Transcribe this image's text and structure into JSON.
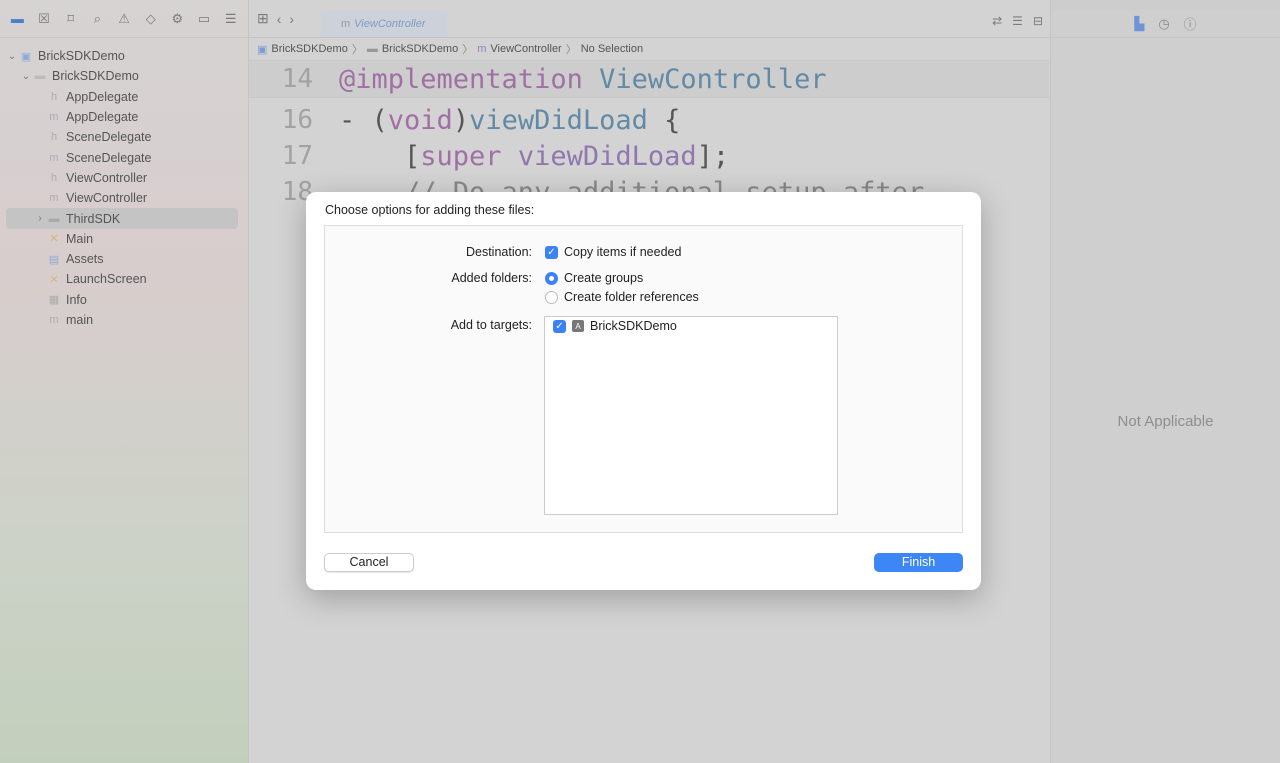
{
  "navigator": {
    "tools": [
      "folder-icon",
      "source-control-icon",
      "bookmark-icon",
      "search-icon",
      "warning-icon",
      "test-icon",
      "debug-icon",
      "breakpoint-icon",
      "report-icon"
    ],
    "items": [
      {
        "label": "BrickSDKDemo",
        "type": "project",
        "level": 0
      },
      {
        "label": "BrickSDKDemo",
        "type": "folder",
        "level": 1
      },
      {
        "label": "AppDelegate",
        "type": "h",
        "level": 2
      },
      {
        "label": "AppDelegate",
        "type": "m",
        "level": 2
      },
      {
        "label": "SceneDelegate",
        "type": "h",
        "level": 2
      },
      {
        "label": "SceneDelegate",
        "type": "m",
        "level": 2
      },
      {
        "label": "ViewController",
        "type": "h",
        "level": 2
      },
      {
        "label": "ViewController",
        "type": "m",
        "level": 2
      },
      {
        "label": "ThirdSDK",
        "type": "folder",
        "level": 2,
        "selected": true
      },
      {
        "label": "Main",
        "type": "storyboard",
        "level": 2
      },
      {
        "label": "Assets",
        "type": "assets",
        "level": 2
      },
      {
        "label": "LaunchScreen",
        "type": "storyboard",
        "level": 2
      },
      {
        "label": "Info",
        "type": "plist",
        "level": 2
      },
      {
        "label": "main",
        "type": "m",
        "level": 2
      }
    ]
  },
  "editor": {
    "tab": {
      "icon": "m",
      "label": "ViewController"
    },
    "breadcrumb": [
      "BrickSDKDemo",
      "BrickSDKDemo",
      "ViewController",
      "No Selection"
    ],
    "lines": [
      {
        "n": "14",
        "a": "@implementation",
        "b": "ViewController"
      },
      {
        "n": "16",
        "a": "- (",
        "b": "void",
        ")": ")",
        "c": "viewDidLoad",
        "d": " {"
      },
      {
        "n": "17",
        "a": "    [",
        "b": "super",
        "c": " viewDidLoad",
        "d": "];"
      },
      {
        "n": "18",
        "a": "    // Do any additional setup after"
      }
    ]
  },
  "inspector": {
    "empty_text": "Not Applicable"
  },
  "dialog": {
    "title": "Choose options for adding these files:",
    "destination_label": "Destination:",
    "copy_items": {
      "label": "Copy items if needed",
      "checked": true
    },
    "added_folders_label": "Added folders:",
    "folder_options": [
      {
        "label": "Create groups",
        "selected": true
      },
      {
        "label": "Create folder references",
        "selected": false
      }
    ],
    "targets_label": "Add to targets:",
    "targets": [
      {
        "label": "BrickSDKDemo",
        "checked": true
      }
    ],
    "cancel": "Cancel",
    "finish": "Finish",
    "accent": "#3d86f5"
  }
}
